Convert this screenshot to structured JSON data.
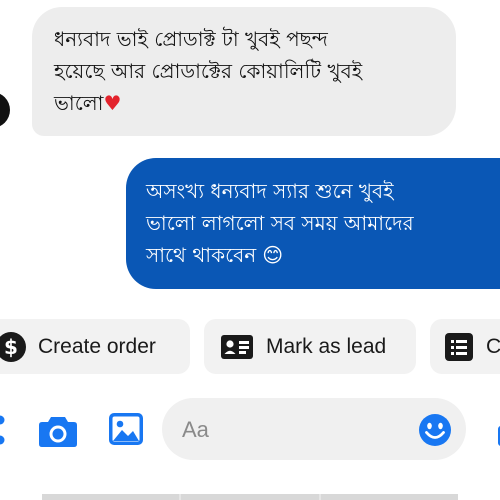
{
  "conversation": {
    "incoming_message": {
      "lines": [
        "ধন্যবাদ ভাই প্রোডাক্ট টা  খুবই পছন্দ",
        "হয়েছে আর প্রোডাক্টের কোয়ালিটি খুবই",
        "ভালো"
      ],
      "emoji": "♥"
    },
    "outgoing_message": {
      "lines": [
        "অসংখ্য ধন্যবাদ স্যার  শুনে খুবই",
        "ভালো লাগলো সব সময় আমাদের",
        "সাথে থাকবেন"
      ],
      "emoji": "😊"
    }
  },
  "quick_actions": {
    "create_order": {
      "label": "Create order",
      "icon": "dollar-circle-icon",
      "glyph": "$"
    },
    "mark_as_lead": {
      "label": "Mark as lead",
      "icon": "id-card-icon"
    },
    "third_action": {
      "label": "C",
      "icon": "receipt-icon"
    }
  },
  "composer": {
    "placeholder": "Aa",
    "icons": [
      "more-icon",
      "camera-icon",
      "gallery-icon",
      "emoji-icon",
      "like-icon"
    ]
  },
  "colors": {
    "accent": "#0a57b5",
    "incoming_bubble": "#ededed",
    "icon_blue": "#1877f2",
    "heart": "#e3232c"
  }
}
